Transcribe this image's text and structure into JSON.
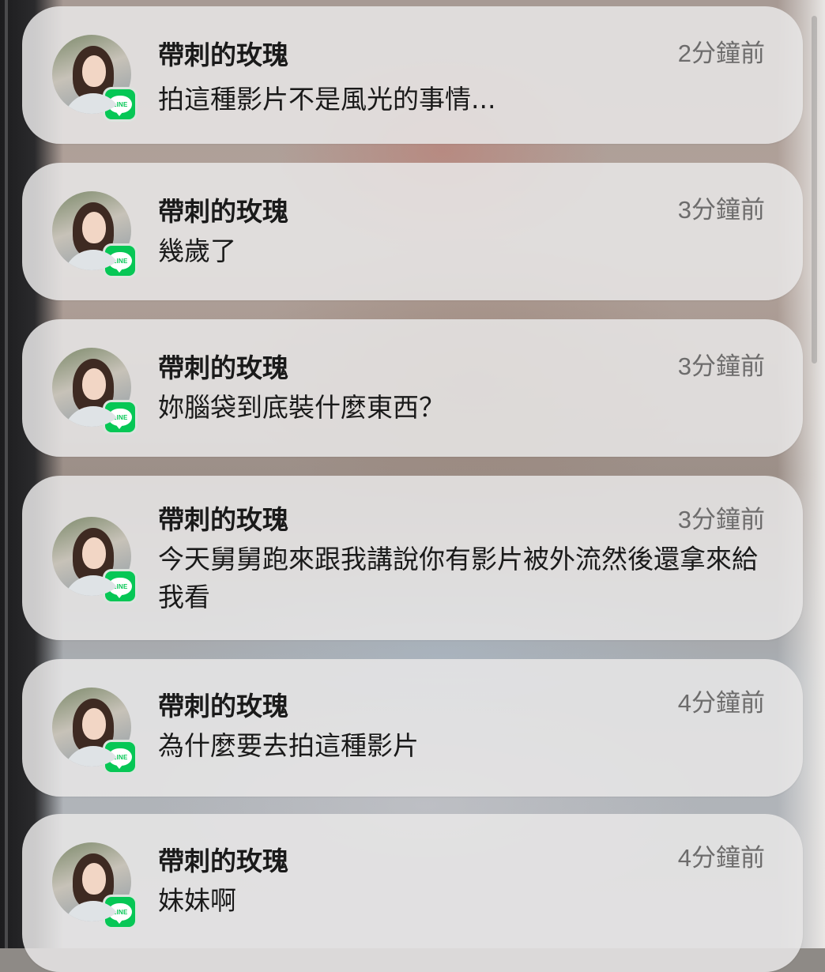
{
  "notifications": [
    {
      "sender": "帶刺的玫瑰",
      "time": "2分鐘前",
      "message": "拍這種影片不是風光的事情...",
      "app": "LINE"
    },
    {
      "sender": "帶刺的玫瑰",
      "time": "3分鐘前",
      "message": "幾歲了",
      "app": "LINE"
    },
    {
      "sender": "帶刺的玫瑰",
      "time": "3分鐘前",
      "message": "妳腦袋到底裝什麼東西？",
      "app": "LINE"
    },
    {
      "sender": "帶刺的玫瑰",
      "time": "3分鐘前",
      "message": "今天舅舅跑來跟我講說你有影片被外流然後還拿來給我看",
      "app": "LINE"
    },
    {
      "sender": "帶刺的玫瑰",
      "time": "4分鐘前",
      "message": "為什麼要去拍這種影片",
      "app": "LINE"
    },
    {
      "sender": "帶刺的玫瑰",
      "time": "4分鐘前",
      "message": "妹妹啊",
      "app": "LINE"
    }
  ],
  "colors": {
    "line_green": "#06c755",
    "card_background": "#e8e6e6",
    "timestamp": "#6d6c6c"
  },
  "icons": {
    "app_icon": "line-app-icon",
    "avatar": "contact-avatar"
  }
}
